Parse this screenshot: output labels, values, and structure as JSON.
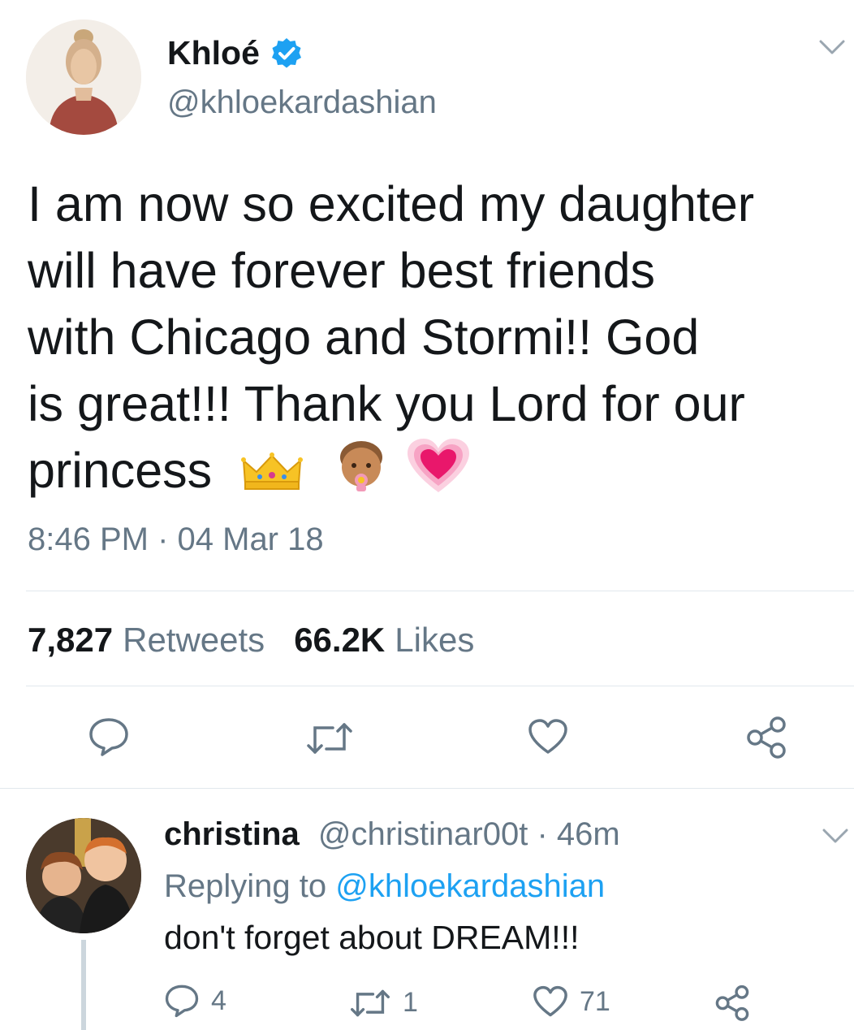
{
  "main_tweet": {
    "author": {
      "name": "Khloé",
      "handle": "@khloekardashian",
      "verified": true
    },
    "text_lines": [
      "I am now so excited my daughter",
      "will have forever best friends",
      "with Chicago and Stormi!! God",
      "is great!!! Thank you Lord for our",
      "princess"
    ],
    "emojis": [
      "crown-emoji",
      "baby-emoji",
      "growing-heart-emoji"
    ],
    "timestamp": "8:46 PM · 04 Mar 18",
    "stats": {
      "retweets_count": "7,827",
      "retweets_label": "Retweets",
      "likes_count": "66.2K",
      "likes_label": "Likes"
    },
    "actions": [
      "reply-icon",
      "retweet-icon",
      "like-icon",
      "share-icon"
    ]
  },
  "reply_tweet": {
    "author": {
      "name": "christina",
      "handle": "@christinar00t",
      "time": " · 46m"
    },
    "replying_prefix": "Replying to ",
    "replying_to": "@khloekardashian",
    "text": "don't forget about DREAM!!!",
    "counts": {
      "replies": "4",
      "retweets": "1",
      "likes": "71"
    }
  },
  "colors": {
    "primary_text": "#14171a",
    "secondary_text": "#657786",
    "link": "#1da1f2",
    "verified": "#1da1f2",
    "divider": "#e1e8ed",
    "icon": "#657786"
  }
}
